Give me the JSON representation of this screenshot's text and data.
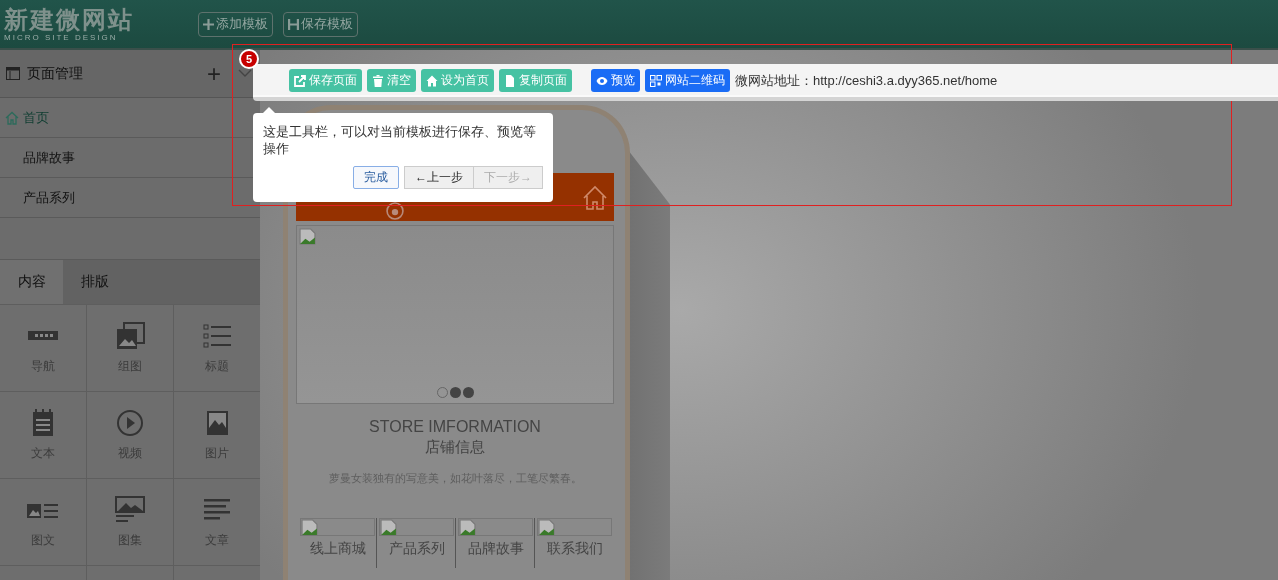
{
  "header": {
    "logo_title": "新建微网站",
    "logo_subtitle": "MICRO SITE DESIGN",
    "buttons": [
      {
        "label": "添加模板"
      },
      {
        "label": "保存模板"
      }
    ]
  },
  "sidebar": {
    "title": "页面管理",
    "add": "+",
    "pages": [
      {
        "label": "首页",
        "selected": true
      },
      {
        "label": "品牌故事",
        "selected": false
      },
      {
        "label": "产品系列",
        "selected": false
      }
    ],
    "tabs": [
      {
        "label": "内容",
        "selected": true
      },
      {
        "label": "排版",
        "selected": false
      }
    ],
    "widgets": [
      {
        "label": "导航"
      },
      {
        "label": "组图"
      },
      {
        "label": "标题"
      },
      {
        "label": "文本"
      },
      {
        "label": "视频"
      },
      {
        "label": "图片"
      },
      {
        "label": "图文"
      },
      {
        "label": "图集"
      },
      {
        "label": "文章"
      }
    ]
  },
  "preview": {
    "banner_dots": [
      {
        "selected": true
      },
      {
        "selected": false
      },
      {
        "selected": false
      }
    ],
    "store_title": "STORE IMFORMATION",
    "store_subtitle": "店铺信息",
    "store_text": "萝曼女装独有的写意美，如花叶落尽，工笔尽繁春。",
    "nav": [
      {
        "label": "线上商城"
      },
      {
        "label": "产品系列"
      },
      {
        "label": "品牌故事"
      },
      {
        "label": "联系我们"
      }
    ]
  },
  "toolbar": {
    "buttons": [
      {
        "label": "保存页面",
        "kind": "green"
      },
      {
        "label": "清空",
        "kind": "green"
      },
      {
        "label": "设为首页",
        "kind": "green"
      },
      {
        "label": "复制页面",
        "kind": "green"
      },
      {
        "label": "预览",
        "kind": "blue"
      },
      {
        "label": "网站二维码",
        "kind": "blue"
      }
    ],
    "site_address": "微网站地址：http://ceshi3.a.dyy365.net/home"
  },
  "tour": {
    "step": "5",
    "text": "这是工具栏，可以对当前模板进行保存、预览等操作",
    "buttons": [
      {
        "label": "完成",
        "kind": "done",
        "disabled": false
      },
      {
        "label": "←上一步",
        "kind": "nav",
        "disabled": false
      },
      {
        "label": "下一步→",
        "kind": "nav",
        "disabled": true
      }
    ]
  }
}
